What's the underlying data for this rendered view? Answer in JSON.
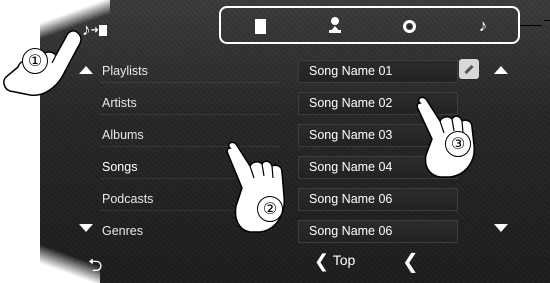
{
  "source_indicator": {
    "icon": "music-to-book-icon",
    "symbol": "♪"
  },
  "tabs": [
    {
      "icon": "book-icon"
    },
    {
      "icon": "artist-icon"
    },
    {
      "icon": "disc-icon"
    },
    {
      "icon": "music-note-icon",
      "symbol": "♪"
    }
  ],
  "categories": [
    {
      "label": "Playlists"
    },
    {
      "label": "Artists"
    },
    {
      "label": "Albums"
    },
    {
      "label": "Songs"
    },
    {
      "label": "Podcasts"
    },
    {
      "label": "Genres"
    }
  ],
  "songs": [
    {
      "label": "Song Name 01"
    },
    {
      "label": "Song Name 02"
    },
    {
      "label": "Song Name 03"
    },
    {
      "label": "Song Name 04"
    },
    {
      "label": "Song Name 06"
    },
    {
      "label": "Song Name 06"
    }
  ],
  "bottom": {
    "back_symbol": "⮌",
    "top_label": "Top",
    "top_chevron": "❮",
    "prev_chevron": "❮"
  },
  "callouts": [
    "①",
    "②",
    "③"
  ]
}
